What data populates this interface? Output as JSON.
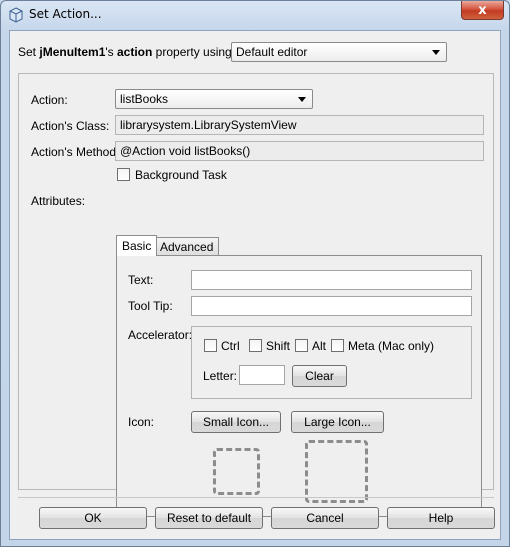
{
  "window": {
    "title": "Set Action...",
    "close_glyph": "x",
    "title_icon": "cube-icon"
  },
  "header": {
    "prefix": "Set ",
    "component": "jMenuItem1",
    "apostrophe": "'s ",
    "property": "action",
    "suffix": " property using:",
    "editor_selected": "Default editor"
  },
  "form": {
    "action_label": "Action:",
    "action_value": "listBooks",
    "class_label": "Action's Class:",
    "class_value": "librarysystem.LibrarySystemView",
    "method_label": "Action's Method:",
    "method_value": "@Action void listBooks()",
    "background_task_label": "Background Task",
    "background_task_checked": false,
    "attributes_label": "Attributes:"
  },
  "tabs": [
    {
      "label": "Basic",
      "active": true
    },
    {
      "label": "Advanced",
      "active": false
    }
  ],
  "basic": {
    "text_label": "Text:",
    "text_value": "",
    "tooltip_label": "Tool Tip:",
    "tooltip_value": "",
    "accelerator_label": "Accelerator:",
    "modifiers": [
      {
        "label": "Ctrl",
        "checked": false
      },
      {
        "label": "Shift",
        "checked": false
      },
      {
        "label": "Alt",
        "checked": false
      },
      {
        "label": "Meta (Mac only)",
        "checked": false
      }
    ],
    "letter_label": "Letter:",
    "letter_value": "",
    "clear_label": "Clear",
    "icon_label": "Icon:",
    "small_icon_label": "Small Icon...",
    "large_icon_label": "Large Icon..."
  },
  "buttons": {
    "ok": "OK",
    "reset": "Reset to default",
    "cancel": "Cancel",
    "help": "Help"
  }
}
